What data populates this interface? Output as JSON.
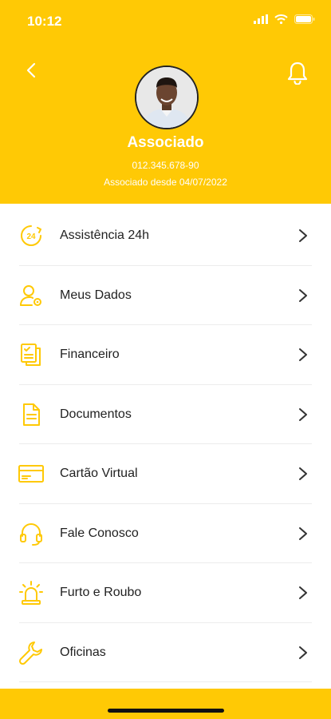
{
  "status": {
    "time": "10:12"
  },
  "profile": {
    "name": "Associado",
    "id": "012.345.678-90",
    "since": "Associado desde 04/07/2022"
  },
  "menu": {
    "items": [
      {
        "label": "Assistência 24h",
        "icon": "assistance-24h-icon"
      },
      {
        "label": "Meus Dados",
        "icon": "user-settings-icon"
      },
      {
        "label": "Financeiro",
        "icon": "financial-docs-icon"
      },
      {
        "label": "Documentos",
        "icon": "document-icon"
      },
      {
        "label": "Cartão Virtual",
        "icon": "credit-card-icon"
      },
      {
        "label": "Fale Conosco",
        "icon": "headset-icon"
      },
      {
        "label": "Furto e Roubo",
        "icon": "alarm-siren-icon"
      },
      {
        "label": "Oficinas",
        "icon": "wrench-icon"
      }
    ]
  },
  "colors": {
    "accent": "#FFC905",
    "text": "#222222",
    "divider": "#ECECEC"
  }
}
